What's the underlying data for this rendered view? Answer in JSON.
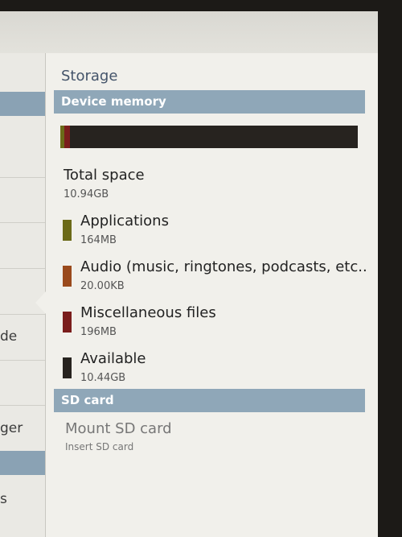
{
  "left_pane": {
    "item_fragment_1": "de",
    "item_fragment_2": "ger",
    "item_fragment_3": "s"
  },
  "storage": {
    "title": "Storage",
    "device_section": "Device memory",
    "usage_bar": [
      {
        "name": "Applications",
        "fraction": 0.0147,
        "color": "#6b6a18"
      },
      {
        "name": "Audio",
        "fraction": 0.0001,
        "color": "#9a4a1c"
      },
      {
        "name": "Miscellaneous files",
        "fraction": 0.0175,
        "color": "#7a1d1c"
      },
      {
        "name": "Available",
        "fraction": 0.9677,
        "color": "#27231f"
      }
    ],
    "total": {
      "label": "Total space",
      "value": "10.94GB"
    },
    "categories": [
      {
        "label": "Applications",
        "value": "164MB",
        "color": "#6b6a18"
      },
      {
        "label": "Audio (music, ringtones, podcasts, etc..",
        "value": "20.00KB",
        "color": "#9a4a1c"
      },
      {
        "label": "Miscellaneous files",
        "value": "196MB",
        "color": "#7a1d1c"
      },
      {
        "label": "Available",
        "value": "10.44GB",
        "color": "#27231f"
      }
    ],
    "sd_section": "SD card",
    "mount": {
      "label": "Mount SD card",
      "sub": "Insert SD card"
    }
  }
}
